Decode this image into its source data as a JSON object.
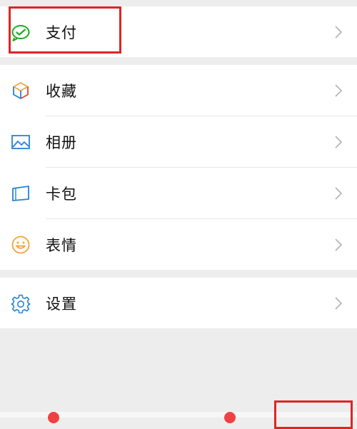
{
  "colors": {
    "background": "#ededed",
    "panel": "#ffffff",
    "highlight": "#e02424",
    "wechat_green": "#1aad19",
    "icon_blue": "#2782d7",
    "icon_orange": "#f2a33a",
    "badge_red": "#f04142"
  },
  "sections": [
    {
      "items": [
        {
          "label": "支付",
          "icon": "wallet-check-icon"
        }
      ]
    },
    {
      "items": [
        {
          "label": "收藏",
          "icon": "cube-icon"
        },
        {
          "label": "相册",
          "icon": "image-icon"
        },
        {
          "label": "卡包",
          "icon": "card-icon"
        },
        {
          "label": "表情",
          "icon": "smiley-icon"
        }
      ]
    },
    {
      "items": [
        {
          "label": "设置",
          "icon": "gear-icon"
        }
      ]
    }
  ]
}
